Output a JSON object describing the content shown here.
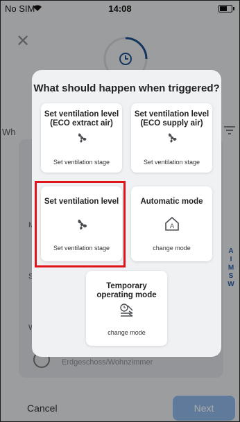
{
  "status_bar": {
    "carrier": "No SIM",
    "time": "14:08"
  },
  "background": {
    "heading_fragment": "Wh",
    "letters": {
      "m": "M",
      "s": "S",
      "w": "W"
    },
    "scroll_index": [
      "A",
      "I",
      "M",
      "S",
      "W"
    ],
    "location": "Erdgeschoss/Wohnzimmer"
  },
  "modal": {
    "title": "What should happen when triggered?",
    "options": [
      {
        "title": "Set ventilation level (ECO extract air)",
        "subtitle": "Set ventilation stage",
        "icon": "fan-icon"
      },
      {
        "title": "Set ventilation level (ECO supply air)",
        "subtitle": "Set ventilation stage",
        "icon": "fan-icon"
      },
      {
        "title": "Set ventilation level",
        "subtitle": "Set ventilation stage",
        "icon": "fan-icon",
        "selected": true
      },
      {
        "title": "Automatic mode",
        "subtitle": "change mode",
        "icon": "auto-mode-icon"
      },
      {
        "title": "Temporary operating mode",
        "subtitle": "change mode",
        "icon": "timer-mode-icon"
      }
    ]
  },
  "footer": {
    "cancel_label": "Cancel",
    "next_label": "Next"
  },
  "colors": {
    "highlight": "#e0131b",
    "accent": "#2b5fa8",
    "next_disabled": "#8eb7e6"
  }
}
